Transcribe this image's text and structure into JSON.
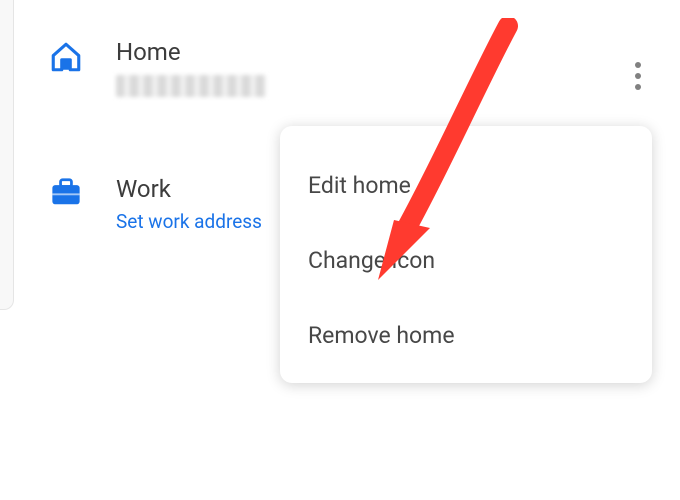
{
  "list": {
    "home": {
      "title": "Home",
      "icon": "home-icon"
    },
    "work": {
      "title": "Work",
      "link": "Set work address",
      "icon": "briefcase-icon"
    }
  },
  "menu": {
    "edit": "Edit home",
    "change_icon": "Change icon",
    "remove": "Remove home"
  },
  "colors": {
    "accent": "#1a73e8",
    "text": "#3c3c3c",
    "arrow": "#ff3a2f"
  }
}
